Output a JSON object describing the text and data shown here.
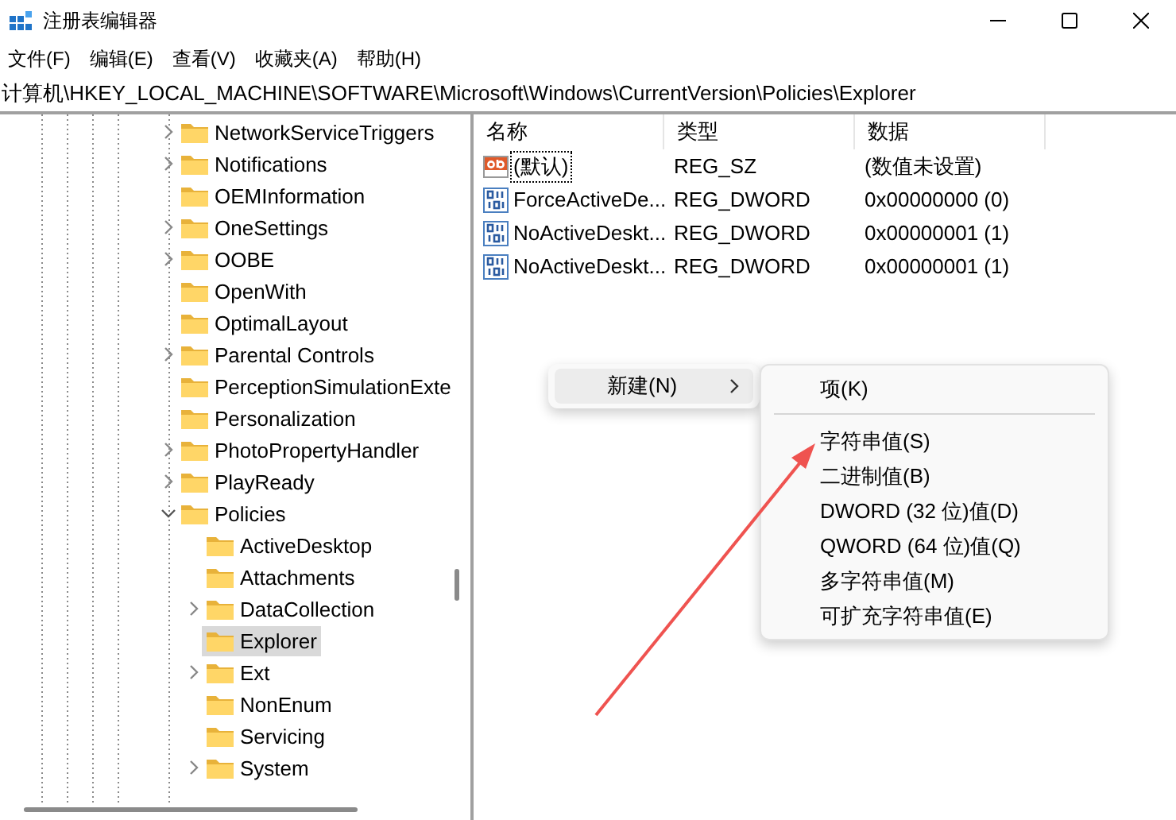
{
  "window": {
    "title": "注册表编辑器"
  },
  "menu_bar": [
    "文件(F)",
    "编辑(E)",
    "查看(V)",
    "收藏夹(A)",
    "帮助(H)"
  ],
  "address_bar": {
    "value": "计算机\\HKEY_LOCAL_MACHINE\\SOFTWARE\\Microsoft\\Windows\\CurrentVersion\\Policies\\Explorer"
  },
  "tree": [
    {
      "kind": "branch",
      "label": "NetworkServiceTriggers",
      "expanded": false,
      "selected": false
    },
    {
      "kind": "branch",
      "label": "Notifications",
      "expanded": false,
      "selected": false
    },
    {
      "kind": "leaf",
      "label": "OEMInformation",
      "selected": false
    },
    {
      "kind": "branch",
      "label": "OneSettings",
      "expanded": false,
      "selected": false
    },
    {
      "kind": "branch",
      "label": "OOBE",
      "expanded": false,
      "selected": false
    },
    {
      "kind": "leaf",
      "label": "OpenWith",
      "selected": false
    },
    {
      "kind": "leaf",
      "label": "OptimalLayout",
      "selected": false
    },
    {
      "kind": "branch",
      "label": "Parental Controls",
      "expanded": false,
      "selected": false
    },
    {
      "kind": "leaf",
      "label": "PerceptionSimulationExte",
      "selected": false
    },
    {
      "kind": "leaf",
      "label": "Personalization",
      "selected": false
    },
    {
      "kind": "branch",
      "label": "PhotoPropertyHandler",
      "expanded": false,
      "selected": false
    },
    {
      "kind": "branch",
      "label": "PlayReady",
      "expanded": false,
      "selected": false
    },
    {
      "kind": "branch",
      "label": "Policies",
      "expanded": true,
      "selected": false,
      "children": [
        {
          "kind": "leaf",
          "label": "ActiveDesktop",
          "selected": false
        },
        {
          "kind": "leaf",
          "label": "Attachments",
          "selected": false
        },
        {
          "kind": "branch",
          "label": "DataCollection",
          "expanded": false,
          "selected": false
        },
        {
          "kind": "leaf",
          "label": "Explorer",
          "selected": true
        },
        {
          "kind": "branch",
          "label": "Ext",
          "expanded": false,
          "selected": false
        },
        {
          "kind": "leaf",
          "label": "NonEnum",
          "selected": false
        },
        {
          "kind": "leaf",
          "label": "Servicing",
          "selected": false
        },
        {
          "kind": "branch",
          "label": "System",
          "expanded": false,
          "selected": false
        }
      ]
    }
  ],
  "values_table": {
    "columns": [
      "名称",
      "类型",
      "数据"
    ],
    "rows": [
      {
        "kind": "string",
        "name": "(默认)",
        "type": "REG_SZ",
        "data": "(数值未设置)",
        "focused": true
      },
      {
        "kind": "binary",
        "name": "ForceActiveDe...",
        "type": "REG_DWORD",
        "data": "0x00000000 (0)",
        "focused": false
      },
      {
        "kind": "binary",
        "name": "NoActiveDeskt...",
        "type": "REG_DWORD",
        "data": "0x00000001 (1)",
        "focused": false
      },
      {
        "kind": "binary",
        "name": "NoActiveDeskt...",
        "type": "REG_DWORD",
        "data": "0x00000001 (1)",
        "focused": false
      }
    ]
  },
  "context_menu": {
    "items": [
      {
        "label": "新建(N)",
        "has_submenu": true,
        "selected": true
      }
    ]
  },
  "submenu": {
    "items": [
      {
        "kind": "item",
        "label": "项(K)"
      },
      {
        "kind": "separator"
      },
      {
        "kind": "item",
        "label": "字符串值(S)"
      },
      {
        "kind": "item",
        "label": "二进制值(B)"
      },
      {
        "kind": "item",
        "label": "DWORD (32 位)值(D)"
      },
      {
        "kind": "item",
        "label": "QWORD (64 位)值(Q)"
      },
      {
        "kind": "item",
        "label": "多字符串值(M)"
      },
      {
        "kind": "item",
        "label": "可扩充字符串值(E)"
      }
    ]
  }
}
